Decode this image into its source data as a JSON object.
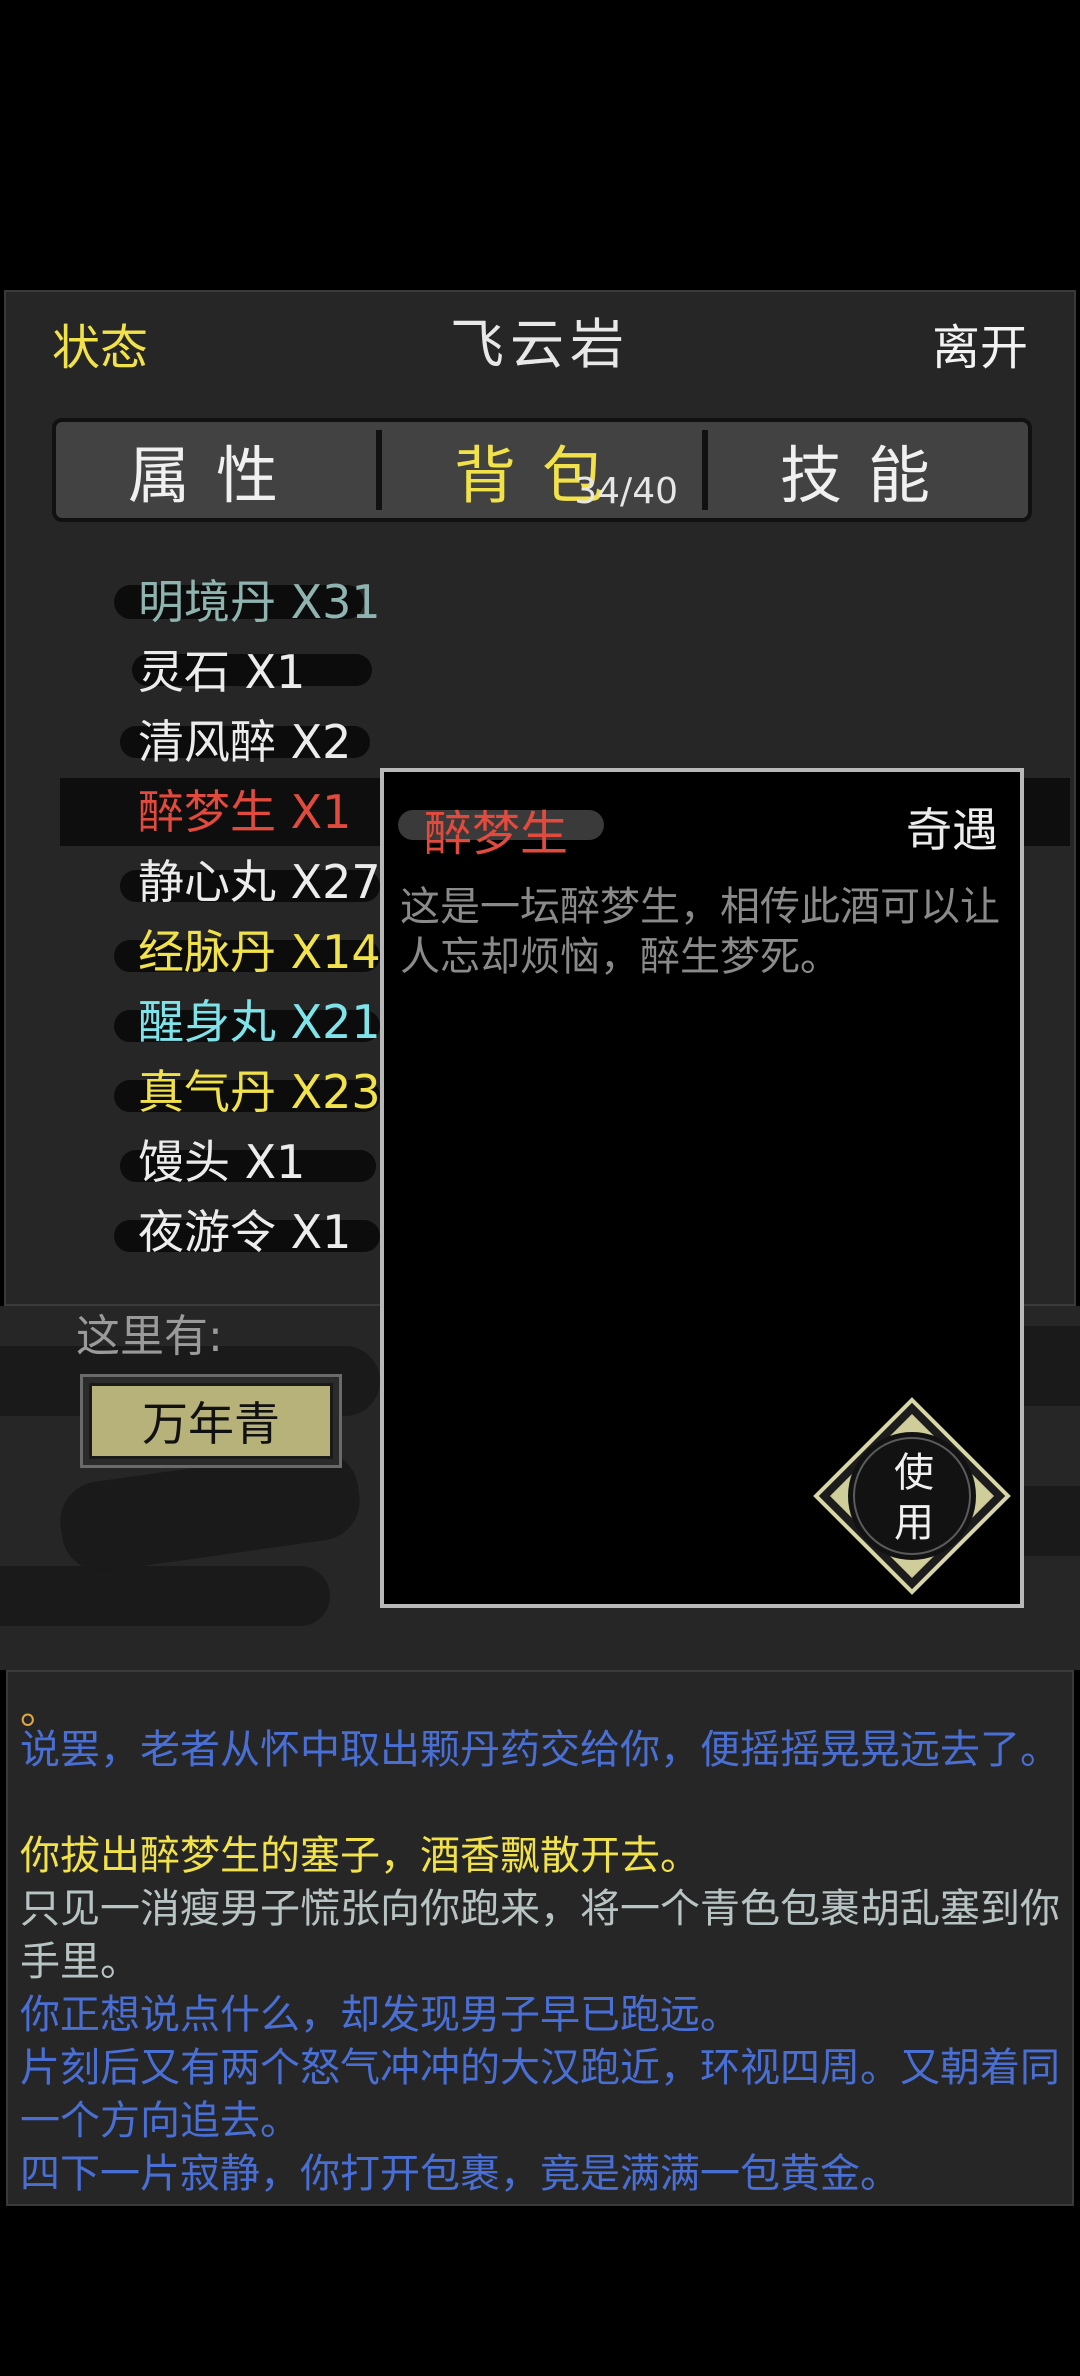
{
  "header": {
    "status_label": "状态",
    "location": "飞云岩",
    "leave_label": "离开"
  },
  "tabs": [
    {
      "label": "属性"
    },
    {
      "label": "背包"
    },
    {
      "label": "技能"
    }
  ],
  "bag_capacity": "34/40",
  "inventory": [
    {
      "label": "明境丹 X31",
      "color": "#8fb4b0"
    },
    {
      "label": "灵石 X1",
      "color": "#ececec"
    },
    {
      "label": "清风醉 X2",
      "color": "#ececec"
    },
    {
      "label": "醉梦生 X1",
      "color": "#e24a3e"
    },
    {
      "label": "静心丸 X27",
      "color": "#ececec"
    },
    {
      "label": "经脉丹 X14",
      "color": "#f2e24a"
    },
    {
      "label": "醒身丸 X21",
      "color": "#7fe3ea"
    },
    {
      "label": "真气丹 X23",
      "color": "#f2e24a"
    },
    {
      "label": "馒头 X1",
      "color": "#ececec"
    },
    {
      "label": "夜游令 X1",
      "color": "#ececec"
    }
  ],
  "scene": {
    "here_label": "这里有:",
    "npc_label": "万年青"
  },
  "item_popup": {
    "name": "醉梦生",
    "type": "奇遇",
    "description": "这是一坛醉梦生，相传此酒可以让人忘却烦恼，醉生梦死。",
    "use_label_1": "使",
    "use_label_2": "用"
  },
  "log": [
    {
      "text": "。",
      "color": "#e0a64a"
    },
    {
      "text": "说罢，老者从怀中取出颗丹药交给你，便摇摇晃晃远去了。",
      "color": "#4a6fd4"
    },
    {
      "text": "你拔出醉梦生的塞子，酒香飘散开去。",
      "color": "#f2e24a"
    },
    {
      "text": "只见一消瘦男子慌张向你跑来，将一个青色包裹胡乱塞到你手里。",
      "color": "#b8c4c4"
    },
    {
      "text": "你正想说点什么，却发现男子早已跑远。",
      "color": "#4a6fd4"
    },
    {
      "text": "片刻后又有两个怒气冲冲的大汉跑近，环视四周。又朝着同一个方向追去。",
      "color": "#4a6fd4"
    },
    {
      "text": "四下一片寂静，你打开包裹，竟是满满一包黄金。",
      "color": "#4a6fd4"
    }
  ]
}
